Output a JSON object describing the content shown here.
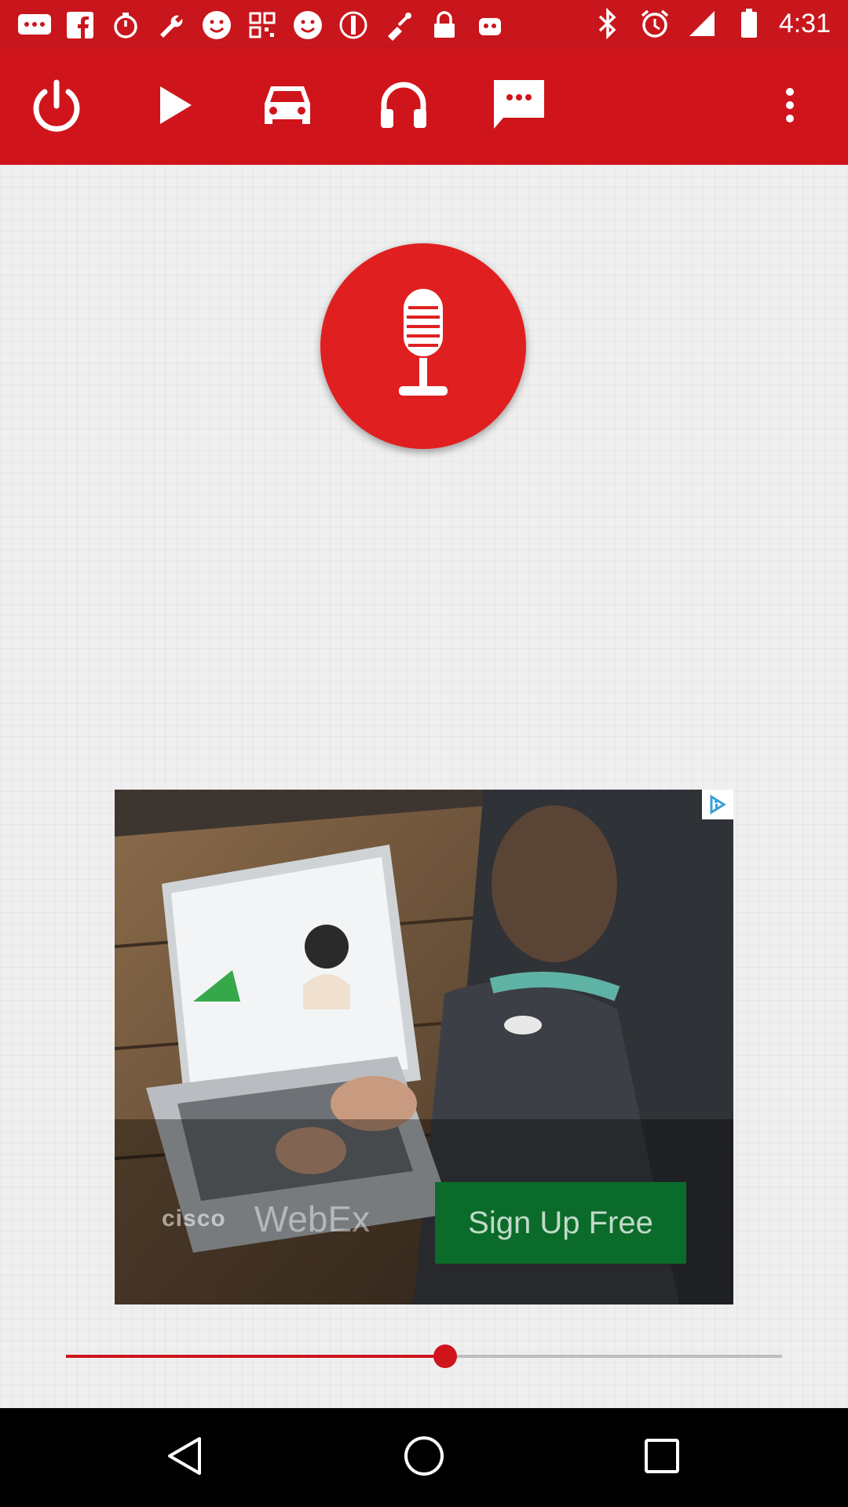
{
  "status_bar": {
    "time": "4:31",
    "icons": [
      "message-icon",
      "facebook-icon",
      "timer-icon",
      "wrench-icon",
      "smiley-icon",
      "qr-icon",
      "smiley-icon",
      "no-entry-icon",
      "fake-gps-icon",
      "lock-icon",
      "robot-icon",
      "bluetooth-icon",
      "alarm-icon",
      "signal-icon",
      "battery-icon"
    ]
  },
  "toolbar": {
    "icons": [
      "power-icon",
      "play-icon",
      "car-icon",
      "headphones-icon",
      "chat-icon",
      "more-vert-icon"
    ]
  },
  "record": {
    "icon": "microphone-icon"
  },
  "ad": {
    "brand": "cisco",
    "product": "WebEx",
    "cta": "Sign Up Free",
    "choices_icon": "adchoices-icon"
  },
  "seekbar": {
    "progress": 0.53
  },
  "nav": {
    "icons": [
      "back-icon",
      "home-icon",
      "recents-icon"
    ]
  },
  "colors": {
    "accent": "#d0141b",
    "record": "#e02020",
    "cta": "#0b6b2a"
  }
}
